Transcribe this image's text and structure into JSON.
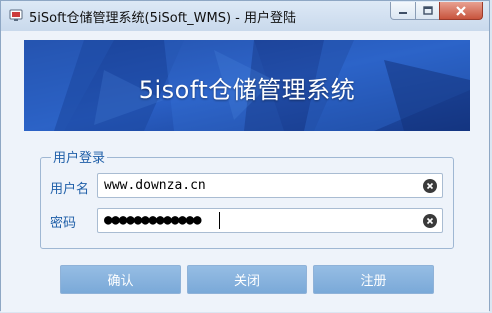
{
  "window": {
    "title": "5iSoft仓储管理系统(5iSoft_WMS) - 用户登陆",
    "icon": "app-icon",
    "controls": [
      "minimize-icon",
      "maximize-icon",
      "close-icon"
    ]
  },
  "banner": {
    "title": "5isoft仓储管理系统"
  },
  "login": {
    "group_label": "用户登录",
    "username_label": "用户名",
    "username_value": "www.downza.cn",
    "password_label": "密码",
    "password_masked": "●●●●●●●●●●●●●"
  },
  "buttons": {
    "confirm": "确认",
    "close": "关闭",
    "register": "注册"
  },
  "colors": {
    "label_blue": "#1f5fa8",
    "button_blue": "#7aa9d8",
    "banner_blue": "#1a4aa6"
  }
}
